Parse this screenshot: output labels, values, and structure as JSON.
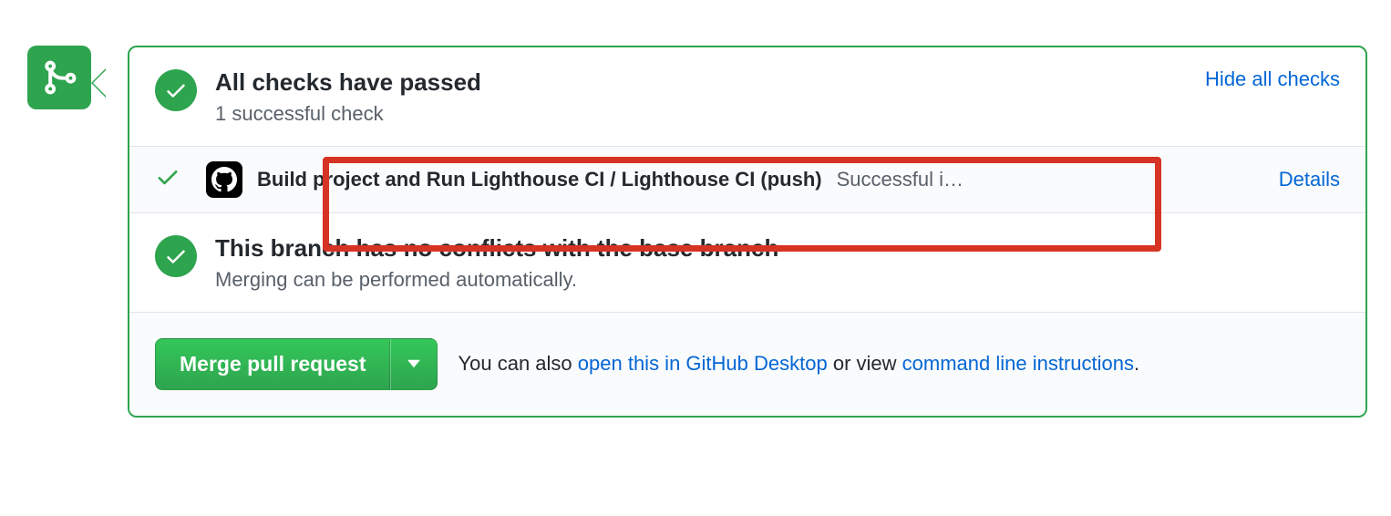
{
  "checks": {
    "title": "All checks have passed",
    "subtitle": "1 successful check",
    "toggle_label": "Hide all checks",
    "items": [
      {
        "name": "Build project and Run Lighthouse CI / Lighthouse CI (push)",
        "status": "Successful i…",
        "details_label": "Details"
      }
    ]
  },
  "merge_status": {
    "title": "This branch has no conflicts with the base branch",
    "subtitle": "Merging can be performed automatically."
  },
  "footer": {
    "merge_button": "Merge pull request",
    "text_prefix": "You can also ",
    "link_desktop": "open this in GitHub Desktop",
    "text_mid": " or view ",
    "link_cli": "command line instructions",
    "text_suffix": "."
  }
}
